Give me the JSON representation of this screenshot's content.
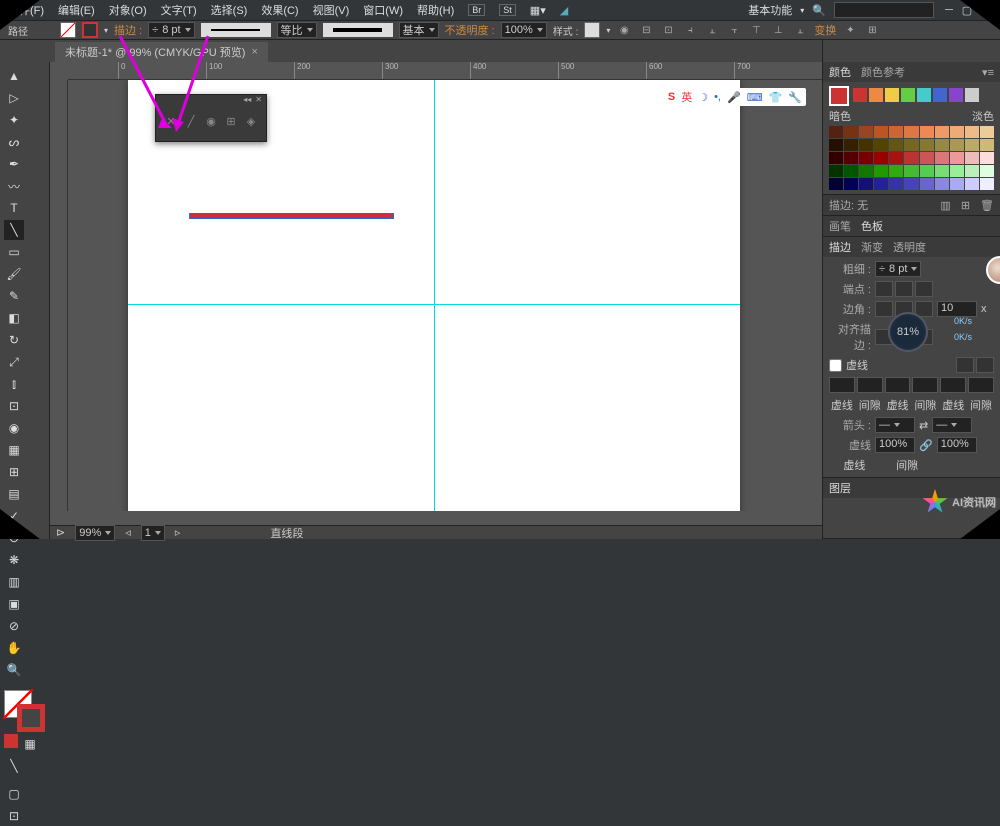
{
  "menu": {
    "file": "文件(F)",
    "edit": "编辑(E)",
    "object": "对象(O)",
    "type": "文字(T)",
    "select": "选择(S)",
    "effect": "效果(C)",
    "view": "视图(V)",
    "window": "窗口(W)",
    "help": "帮助(H)",
    "essentials": "基本功能"
  },
  "context": {
    "path": "路径",
    "stroke": "描边 :",
    "stroke_val": "8 pt",
    "uniform": "等比",
    "basic": "基本",
    "opacity": "不透明度 :",
    "opacity_val": "100%",
    "style": "样式 :",
    "transform": "变换"
  },
  "doc": {
    "tab": "未标题-1* @ 99% (CMYK/GPU 预览)"
  },
  "ruler": {
    "t0": "0",
    "t1": "100",
    "t2": "200",
    "t3": "300",
    "t4": "400",
    "t5": "500",
    "t6": "600",
    "t7": "700"
  },
  "panels": {
    "color": "颜色",
    "color_guide": "颜色参考",
    "dark": "暗色",
    "light": "淡色",
    "stroke_panel": "描边",
    "none": "描边: 无",
    "brushes": "画笔",
    "swatch_tab": "色板",
    "stroke_tab": "描边",
    "gradient": "渐变",
    "transparency": "透明度",
    "weight": "粗细 :",
    "weight_val": "8 pt",
    "cap": "端点 :",
    "corner": "边角 :",
    "corner_val": "10",
    "align": "对齐描边 :",
    "dashed": "虚线",
    "d1": "虚线",
    "d2": "间隙",
    "d3": "虚线",
    "d4": "间隙",
    "d5": "虚线",
    "d6": "间隙",
    "arrowheads": "箭头 :",
    "scale_val": "100%",
    "scale_val2": "100%",
    "dash_lbl": "虚线",
    "gap_lbl": "间隙",
    "dashed_line": "虚线",
    "layers": "图层"
  },
  "status": {
    "zoom": "99%",
    "page": "1",
    "tool": "直线段"
  },
  "dial": {
    "val": "81%"
  },
  "ime": {
    "cn": "英"
  },
  "watermark": {
    "text": "AI资讯网"
  }
}
